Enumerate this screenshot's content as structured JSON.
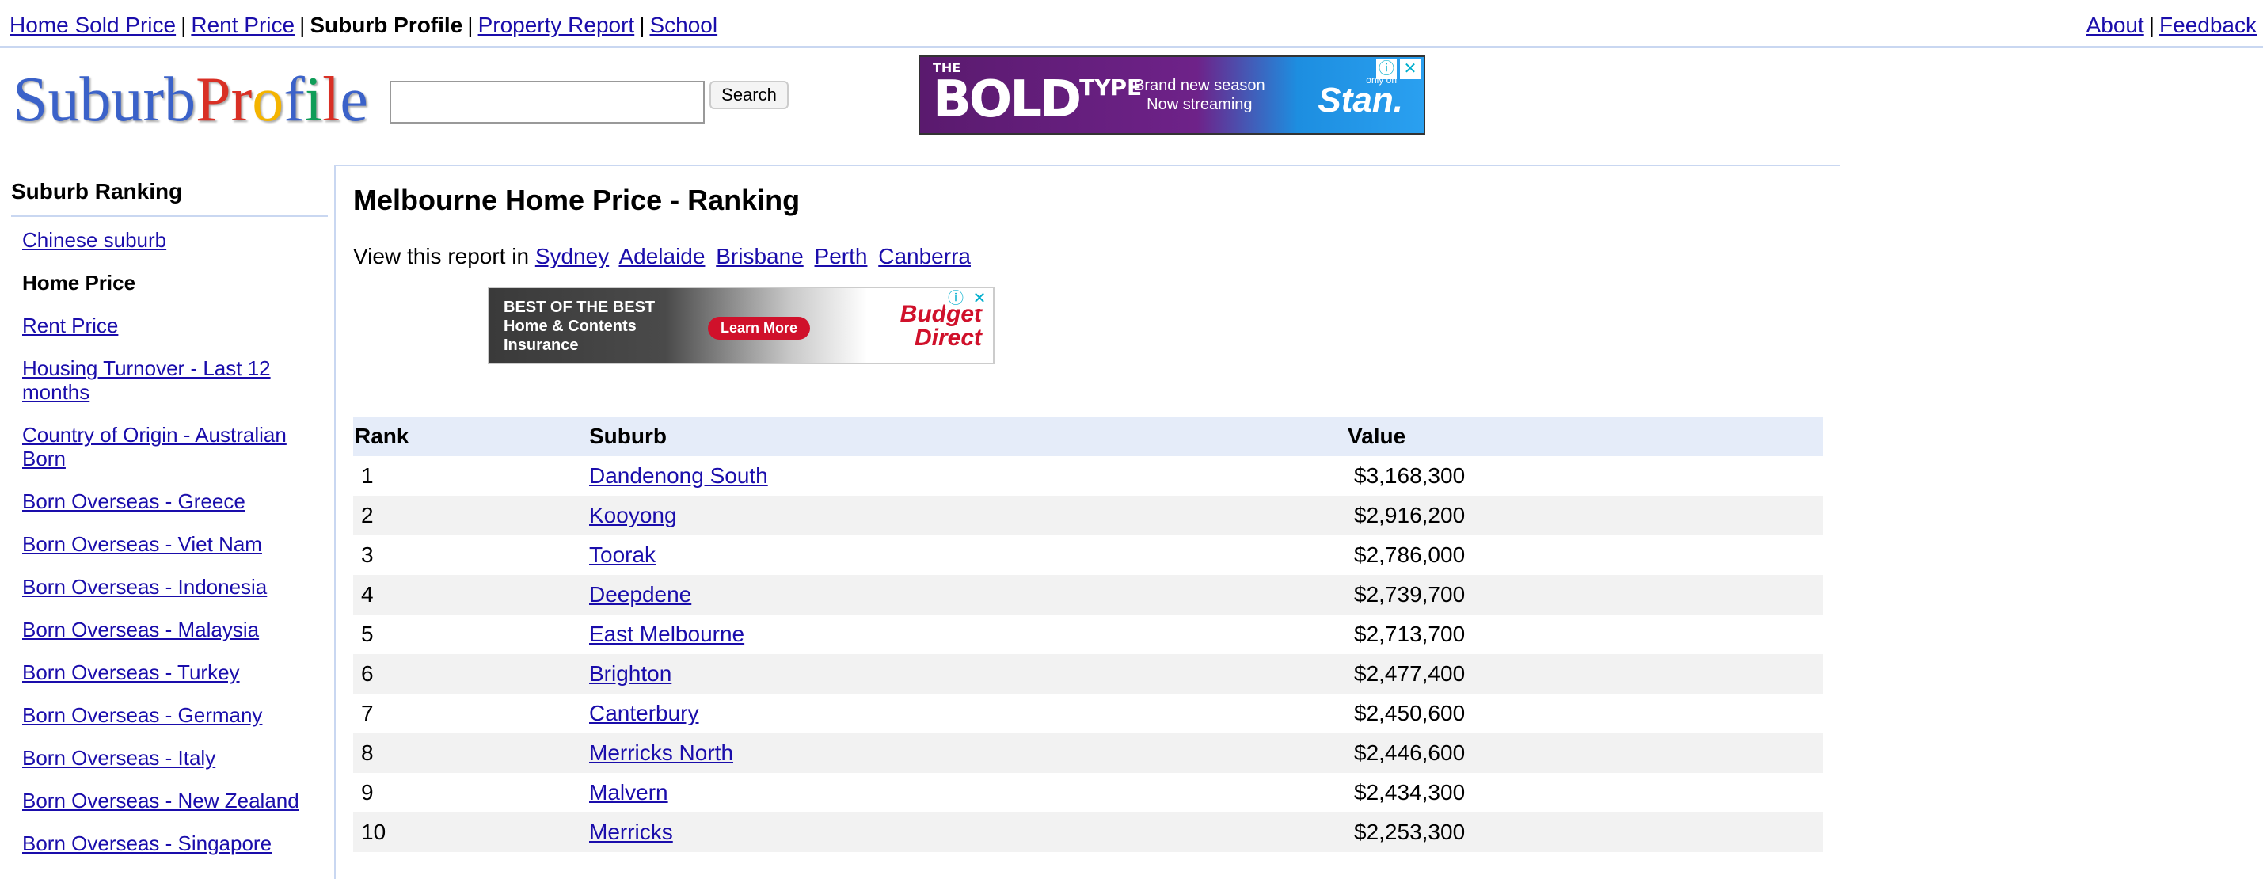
{
  "topnav": {
    "items": [
      {
        "label": "Home Sold Price"
      },
      {
        "label": "Rent Price"
      },
      {
        "label": "Suburb Profile"
      },
      {
        "label": "Property Report"
      },
      {
        "label": "School"
      }
    ],
    "right": [
      {
        "label": "About"
      },
      {
        "label": "Feedback"
      }
    ],
    "separator": "|"
  },
  "logo": {
    "letters": [
      "S",
      "u",
      "b",
      "u",
      "r",
      "b",
      "P",
      "r",
      "o",
      "f",
      "i",
      "l",
      "e"
    ]
  },
  "search": {
    "value": "",
    "button_label": "Search"
  },
  "ad_top": {
    "the": "THE",
    "bold": "BOLD",
    "type": "TYPE",
    "tagline_1": "Brand new season",
    "tagline_2": "Now streaming",
    "stan_note": "only on",
    "brand": "Stan."
  },
  "ad_mid": {
    "line_1": "BEST OF THE BEST",
    "line_2": "Home & Contents",
    "line_3": "Insurance",
    "button": "Learn More",
    "brand_1": "Budget",
    "brand_2": "Direct"
  },
  "ad_controls": {
    "info": "ⓘ",
    "close": "✕"
  },
  "sidebar": {
    "title": "Suburb Ranking",
    "items": [
      {
        "label": "Chinese suburb",
        "active": false
      },
      {
        "label": "Home Price",
        "active": true
      },
      {
        "label": "Rent Price",
        "active": false
      },
      {
        "label": "Housing Turnover - Last 12 months",
        "active": false
      },
      {
        "label": "Country of Origin - Australian Born",
        "active": false
      },
      {
        "label": "Born Overseas - Greece",
        "active": false
      },
      {
        "label": "Born Overseas - Viet Nam",
        "active": false
      },
      {
        "label": "Born Overseas - Indonesia",
        "active": false
      },
      {
        "label": "Born Overseas - Malaysia",
        "active": false
      },
      {
        "label": "Born Overseas - Turkey",
        "active": false
      },
      {
        "label": "Born Overseas - Germany",
        "active": false
      },
      {
        "label": "Born Overseas - Italy",
        "active": false
      },
      {
        "label": "Born Overseas - New Zealand",
        "active": false
      },
      {
        "label": "Born Overseas - Singapore",
        "active": false
      }
    ]
  },
  "main": {
    "title": "Melbourne Home Price - Ranking",
    "view_prefix": "View this report in",
    "cities": [
      "Sydney",
      "Adelaide",
      "Brisbane",
      "Perth",
      "Canberra"
    ],
    "table": {
      "headers": [
        "Rank",
        "Suburb",
        "Value"
      ],
      "rows": [
        {
          "rank": "1",
          "suburb": "Dandenong South",
          "value": "$3,168,300"
        },
        {
          "rank": "2",
          "suburb": "Kooyong",
          "value": "$2,916,200"
        },
        {
          "rank": "3",
          "suburb": "Toorak",
          "value": "$2,786,000"
        },
        {
          "rank": "4",
          "suburb": "Deepdene",
          "value": "$2,739,700"
        },
        {
          "rank": "5",
          "suburb": "East Melbourne",
          "value": "$2,713,700"
        },
        {
          "rank": "6",
          "suburb": "Brighton",
          "value": "$2,477,400"
        },
        {
          "rank": "7",
          "suburb": "Canterbury",
          "value": "$2,450,600"
        },
        {
          "rank": "8",
          "suburb": "Merricks North",
          "value": "$2,446,600"
        },
        {
          "rank": "9",
          "suburb": "Malvern",
          "value": "$2,434,300"
        },
        {
          "rank": "10",
          "suburb": "Merricks",
          "value": "$2,253,300"
        }
      ]
    }
  },
  "colors": {
    "link": "#1a0dab",
    "header_bg": "#e5ecf9",
    "row_alt": "#f2f2f2",
    "rule": "#c9d7f1",
    "logo_letters": [
      "#3b62c9",
      "#3b62c9",
      "#3b62c9",
      "#3b62c9",
      "#3b62c9",
      "#3b62c9",
      "#d93025",
      "#d93025",
      "#f4b400",
      "#3b62c9",
      "#0f9d58",
      "#d93025",
      "#3b62c9"
    ]
  }
}
